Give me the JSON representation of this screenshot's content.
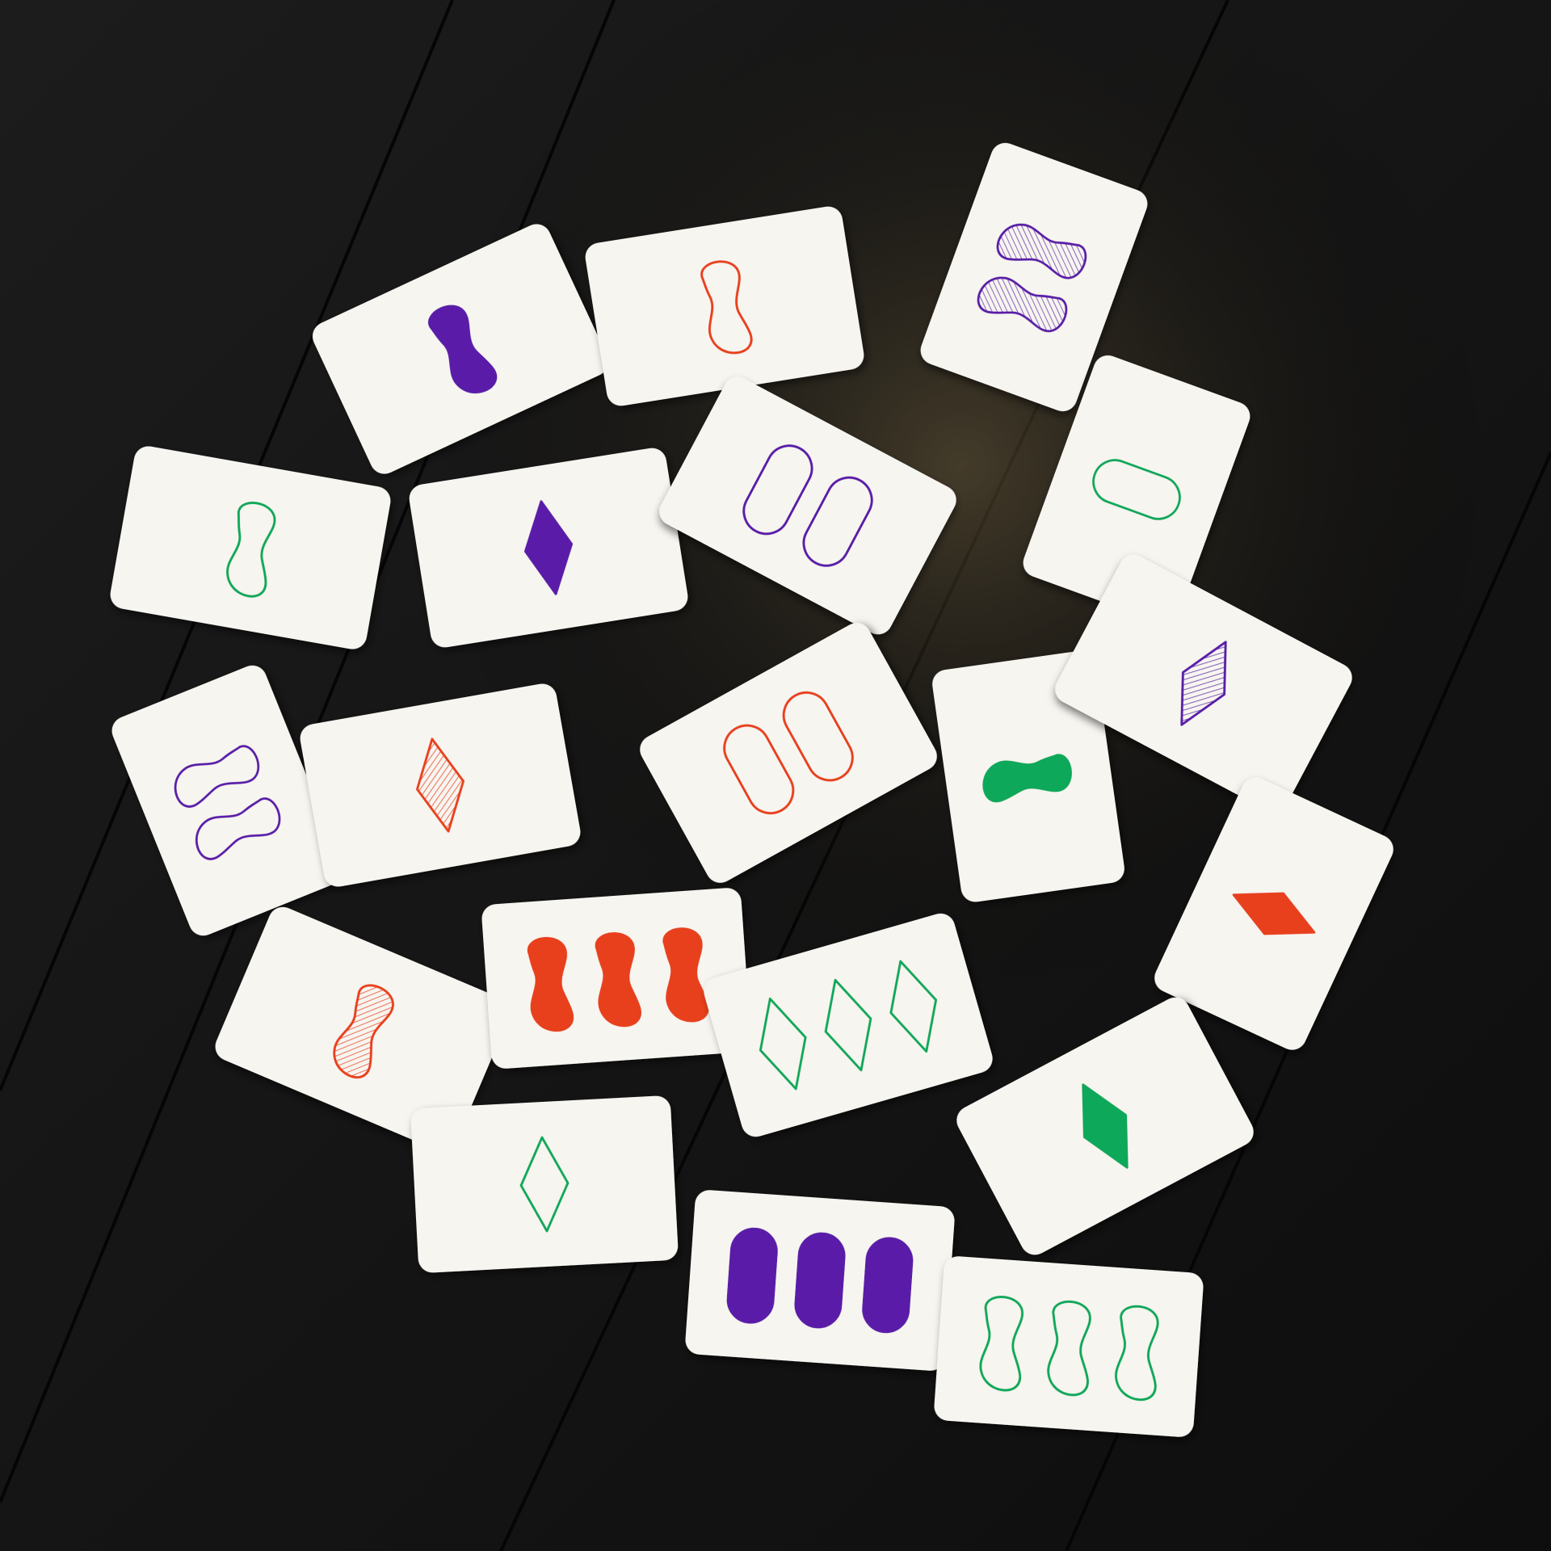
{
  "colors": {
    "table": "#161616",
    "card": "#f7f5f0",
    "red": "#e8401c",
    "green": "#10a85a",
    "purple": "#5a1fa8"
  },
  "cards": [
    {
      "count": 1,
      "shape": "squiggle",
      "color": "purple",
      "shading": "solid"
    },
    {
      "count": 1,
      "shape": "squiggle",
      "color": "red",
      "shading": "open"
    },
    {
      "count": 2,
      "shape": "squiggle",
      "color": "purple",
      "shading": "striped"
    },
    {
      "count": 1,
      "shape": "squiggle",
      "color": "green",
      "shading": "open"
    },
    {
      "count": 1,
      "shape": "diamond",
      "color": "purple",
      "shading": "solid"
    },
    {
      "count": 2,
      "shape": "oval",
      "color": "purple",
      "shading": "open"
    },
    {
      "count": 1,
      "shape": "oval",
      "color": "green",
      "shading": "open"
    },
    {
      "count": 2,
      "shape": "squiggle",
      "color": "purple",
      "shading": "open"
    },
    {
      "count": 1,
      "shape": "diamond",
      "color": "red",
      "shading": "striped"
    },
    {
      "count": 2,
      "shape": "oval",
      "color": "red",
      "shading": "open"
    },
    {
      "count": 1,
      "shape": "squiggle",
      "color": "green",
      "shading": "solid"
    },
    {
      "count": 1,
      "shape": "diamond",
      "color": "purple",
      "shading": "striped"
    },
    {
      "count": 1,
      "shape": "diamond",
      "color": "red",
      "shading": "solid"
    },
    {
      "count": 1,
      "shape": "squiggle",
      "color": "red",
      "shading": "striped"
    },
    {
      "count": 3,
      "shape": "squiggle",
      "color": "red",
      "shading": "solid"
    },
    {
      "count": 3,
      "shape": "diamond",
      "color": "green",
      "shading": "open"
    },
    {
      "count": 1,
      "shape": "diamond",
      "color": "green",
      "shading": "solid"
    },
    {
      "count": 1,
      "shape": "diamond",
      "color": "green",
      "shading": "open"
    },
    {
      "count": 3,
      "shape": "oval",
      "color": "purple",
      "shading": "solid"
    },
    {
      "count": 3,
      "shape": "squiggle",
      "color": "green",
      "shading": "open"
    }
  ]
}
